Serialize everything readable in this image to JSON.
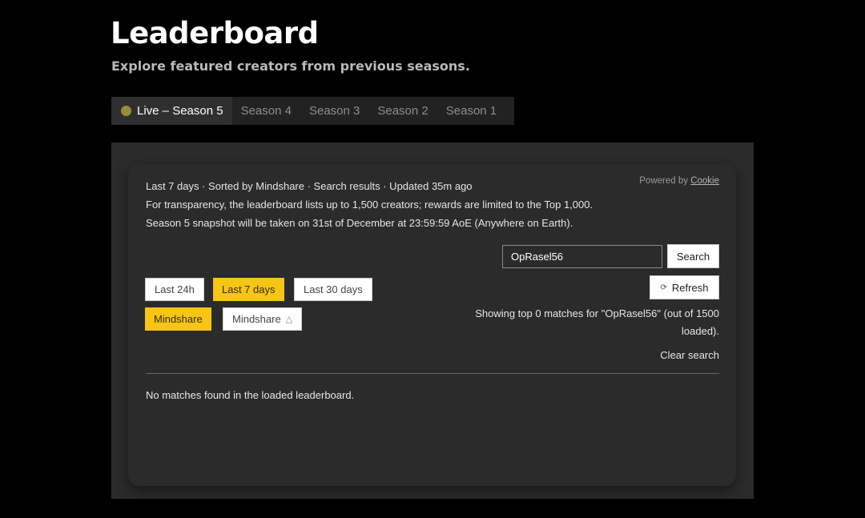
{
  "header": {
    "title": "Leaderboard",
    "subtitle": "Explore featured creators from previous seasons."
  },
  "tabs": [
    {
      "label": "Live – Season 5",
      "active": true
    },
    {
      "label": "Season 4",
      "active": false
    },
    {
      "label": "Season 3",
      "active": false
    },
    {
      "label": "Season 2",
      "active": false
    },
    {
      "label": "Season 1",
      "active": false
    }
  ],
  "panel": {
    "meta_lines": [
      "Last 7 days · Sorted by Mindshare · Search results · Updated 35m ago",
      "For transparency, the leaderboard lists up to 1,500 creators; rewards are limited to the Top 1,000.",
      "Season 5 snapshot will be taken on 31st of December at 23:59:59 AoE (Anywhere on Earth)."
    ],
    "powered_prefix": "Powered by",
    "powered_link": "Cookie",
    "search": {
      "value": "OpRasel56",
      "button": "Search"
    },
    "refresh": {
      "icon": "refresh-icon",
      "glyph": "⟳",
      "label": "Refresh"
    },
    "time_filters": [
      {
        "label": "Last 24h",
        "active": false
      },
      {
        "label": "Last 7 days",
        "active": true
      },
      {
        "label": "Last 30 days",
        "active": false
      }
    ],
    "sort_filters": [
      {
        "label": "Mindshare",
        "active": true
      },
      {
        "label": "Mindshare",
        "active": false,
        "icon": "triangle-up-icon",
        "glyph": "△"
      }
    ],
    "showing_text": "Showing top 0 matches for \"OpRasel56\" (out of 1500 loaded).",
    "clear_search": "Clear search",
    "no_matches": "No matches found in the loaded leaderboard."
  },
  "colors": {
    "background": "#000000",
    "panel": "#2b2b2b",
    "accent": "#f5c518",
    "live_dot": "#9c8a3c"
  }
}
